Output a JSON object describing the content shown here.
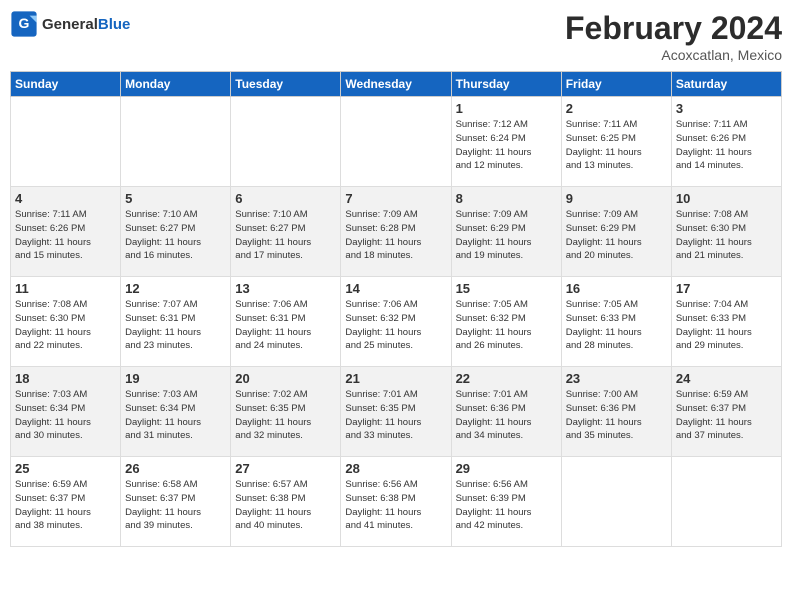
{
  "header": {
    "logo_line1": "General",
    "logo_line2": "Blue",
    "month": "February 2024",
    "location": "Acoxcatlan, Mexico"
  },
  "weekdays": [
    "Sunday",
    "Monday",
    "Tuesday",
    "Wednesday",
    "Thursday",
    "Friday",
    "Saturday"
  ],
  "weeks": [
    [
      {
        "day": "",
        "info": ""
      },
      {
        "day": "",
        "info": ""
      },
      {
        "day": "",
        "info": ""
      },
      {
        "day": "",
        "info": ""
      },
      {
        "day": "1",
        "info": "Sunrise: 7:12 AM\nSunset: 6:24 PM\nDaylight: 11 hours\nand 12 minutes."
      },
      {
        "day": "2",
        "info": "Sunrise: 7:11 AM\nSunset: 6:25 PM\nDaylight: 11 hours\nand 13 minutes."
      },
      {
        "day": "3",
        "info": "Sunrise: 7:11 AM\nSunset: 6:26 PM\nDaylight: 11 hours\nand 14 minutes."
      }
    ],
    [
      {
        "day": "4",
        "info": "Sunrise: 7:11 AM\nSunset: 6:26 PM\nDaylight: 11 hours\nand 15 minutes."
      },
      {
        "day": "5",
        "info": "Sunrise: 7:10 AM\nSunset: 6:27 PM\nDaylight: 11 hours\nand 16 minutes."
      },
      {
        "day": "6",
        "info": "Sunrise: 7:10 AM\nSunset: 6:27 PM\nDaylight: 11 hours\nand 17 minutes."
      },
      {
        "day": "7",
        "info": "Sunrise: 7:09 AM\nSunset: 6:28 PM\nDaylight: 11 hours\nand 18 minutes."
      },
      {
        "day": "8",
        "info": "Sunrise: 7:09 AM\nSunset: 6:29 PM\nDaylight: 11 hours\nand 19 minutes."
      },
      {
        "day": "9",
        "info": "Sunrise: 7:09 AM\nSunset: 6:29 PM\nDaylight: 11 hours\nand 20 minutes."
      },
      {
        "day": "10",
        "info": "Sunrise: 7:08 AM\nSunset: 6:30 PM\nDaylight: 11 hours\nand 21 minutes."
      }
    ],
    [
      {
        "day": "11",
        "info": "Sunrise: 7:08 AM\nSunset: 6:30 PM\nDaylight: 11 hours\nand 22 minutes."
      },
      {
        "day": "12",
        "info": "Sunrise: 7:07 AM\nSunset: 6:31 PM\nDaylight: 11 hours\nand 23 minutes."
      },
      {
        "day": "13",
        "info": "Sunrise: 7:06 AM\nSunset: 6:31 PM\nDaylight: 11 hours\nand 24 minutes."
      },
      {
        "day": "14",
        "info": "Sunrise: 7:06 AM\nSunset: 6:32 PM\nDaylight: 11 hours\nand 25 minutes."
      },
      {
        "day": "15",
        "info": "Sunrise: 7:05 AM\nSunset: 6:32 PM\nDaylight: 11 hours\nand 26 minutes."
      },
      {
        "day": "16",
        "info": "Sunrise: 7:05 AM\nSunset: 6:33 PM\nDaylight: 11 hours\nand 28 minutes."
      },
      {
        "day": "17",
        "info": "Sunrise: 7:04 AM\nSunset: 6:33 PM\nDaylight: 11 hours\nand 29 minutes."
      }
    ],
    [
      {
        "day": "18",
        "info": "Sunrise: 7:03 AM\nSunset: 6:34 PM\nDaylight: 11 hours\nand 30 minutes."
      },
      {
        "day": "19",
        "info": "Sunrise: 7:03 AM\nSunset: 6:34 PM\nDaylight: 11 hours\nand 31 minutes."
      },
      {
        "day": "20",
        "info": "Sunrise: 7:02 AM\nSunset: 6:35 PM\nDaylight: 11 hours\nand 32 minutes."
      },
      {
        "day": "21",
        "info": "Sunrise: 7:01 AM\nSunset: 6:35 PM\nDaylight: 11 hours\nand 33 minutes."
      },
      {
        "day": "22",
        "info": "Sunrise: 7:01 AM\nSunset: 6:36 PM\nDaylight: 11 hours\nand 34 minutes."
      },
      {
        "day": "23",
        "info": "Sunrise: 7:00 AM\nSunset: 6:36 PM\nDaylight: 11 hours\nand 35 minutes."
      },
      {
        "day": "24",
        "info": "Sunrise: 6:59 AM\nSunset: 6:37 PM\nDaylight: 11 hours\nand 37 minutes."
      }
    ],
    [
      {
        "day": "25",
        "info": "Sunrise: 6:59 AM\nSunset: 6:37 PM\nDaylight: 11 hours\nand 38 minutes."
      },
      {
        "day": "26",
        "info": "Sunrise: 6:58 AM\nSunset: 6:37 PM\nDaylight: 11 hours\nand 39 minutes."
      },
      {
        "day": "27",
        "info": "Sunrise: 6:57 AM\nSunset: 6:38 PM\nDaylight: 11 hours\nand 40 minutes."
      },
      {
        "day": "28",
        "info": "Sunrise: 6:56 AM\nSunset: 6:38 PM\nDaylight: 11 hours\nand 41 minutes."
      },
      {
        "day": "29",
        "info": "Sunrise: 6:56 AM\nSunset: 6:39 PM\nDaylight: 11 hours\nand 42 minutes."
      },
      {
        "day": "",
        "info": ""
      },
      {
        "day": "",
        "info": ""
      }
    ]
  ]
}
